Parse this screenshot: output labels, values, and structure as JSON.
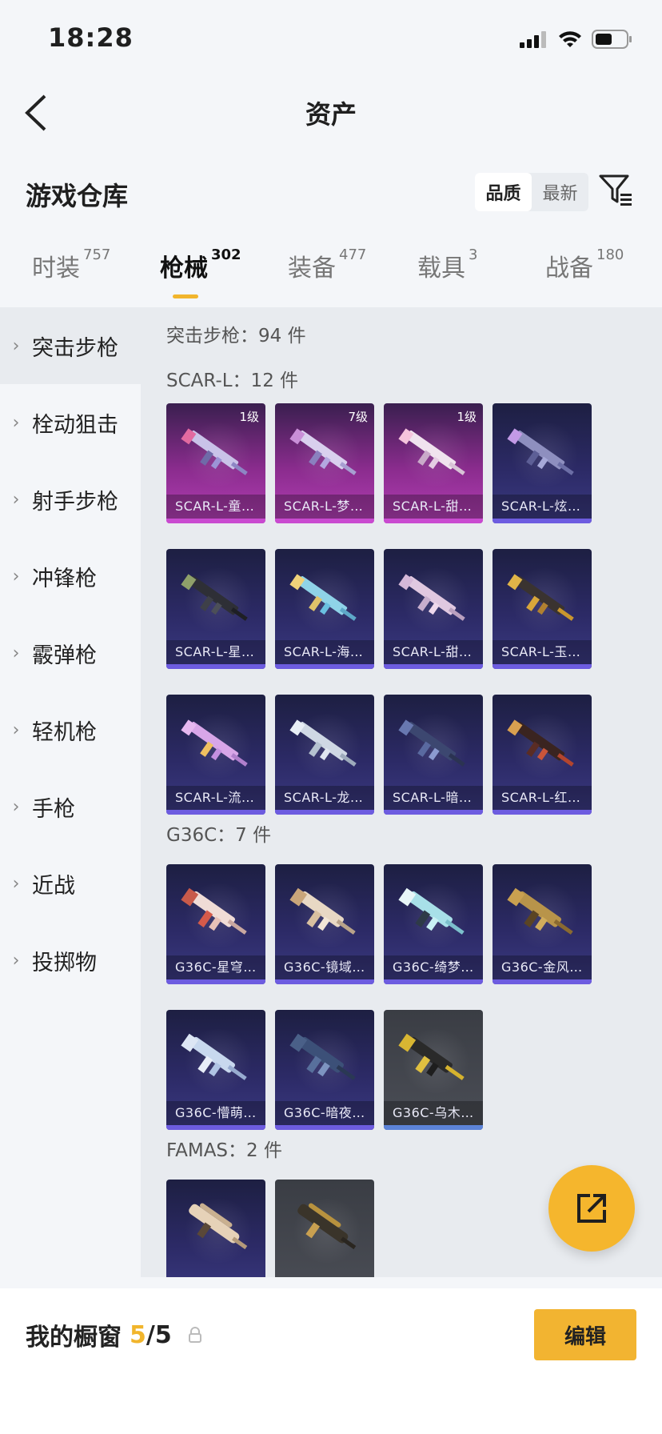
{
  "status_bar": {
    "time": "18:28"
  },
  "nav": {
    "title": "资产"
  },
  "header": {
    "title": "游戏仓库",
    "sort_options": [
      "品质",
      "最新"
    ]
  },
  "tabs": [
    {
      "label": "时装",
      "count": "757"
    },
    {
      "label": "枪械",
      "count": "302"
    },
    {
      "label": "装备",
      "count": "477"
    },
    {
      "label": "载具",
      "count": "3"
    },
    {
      "label": "战备",
      "count": "180"
    }
  ],
  "sidebar": {
    "items": [
      "突击步枪",
      "栓动狙击",
      "射手步枪",
      "冲锋枪",
      "霰弹枪",
      "轻机枪",
      "手枪",
      "近战",
      "投掷物"
    ]
  },
  "content": {
    "category_header": "突击步枪：94 件",
    "groups": [
      {
        "label": "SCAR-L：12 件",
        "items": [
          {
            "name": "SCAR-L-童…",
            "level": "1级"
          },
          {
            "name": "SCAR-L-梦…",
            "level": "7级"
          },
          {
            "name": "SCAR-L-甜…",
            "level": "1级"
          },
          {
            "name": "SCAR-L-炫…"
          },
          {
            "name": "SCAR-L-星…"
          },
          {
            "name": "SCAR-L-海…"
          },
          {
            "name": "SCAR-L-甜…"
          },
          {
            "name": "SCAR-L-玉…"
          },
          {
            "name": "SCAR-L-流…"
          },
          {
            "name": "SCAR-L-龙…"
          },
          {
            "name": "SCAR-L-暗…"
          },
          {
            "name": "SCAR-L-红…"
          }
        ]
      },
      {
        "label": "G36C：7 件",
        "items": [
          {
            "name": "G36C-星穹…"
          },
          {
            "name": "G36C-镜域…"
          },
          {
            "name": "G36C-绮梦…"
          },
          {
            "name": "G36C-金风…"
          },
          {
            "name": "G36C-懵萌…"
          },
          {
            "name": "G36C-暗夜…"
          },
          {
            "name": "G36C-乌木…"
          }
        ]
      },
      {
        "label": "FAMAS：2 件",
        "items": [
          {
            "name": ""
          },
          {
            "name": ""
          }
        ]
      }
    ]
  },
  "bottom": {
    "showcase_label": "我的橱窗",
    "current": "5",
    "total": "/5",
    "edit_label": "编辑"
  },
  "colors": {
    "accent": "#f1b52c",
    "card_purple": "#2c2a66",
    "card_pink": "#b33fb5",
    "card_gray": "#4b4e56"
  }
}
